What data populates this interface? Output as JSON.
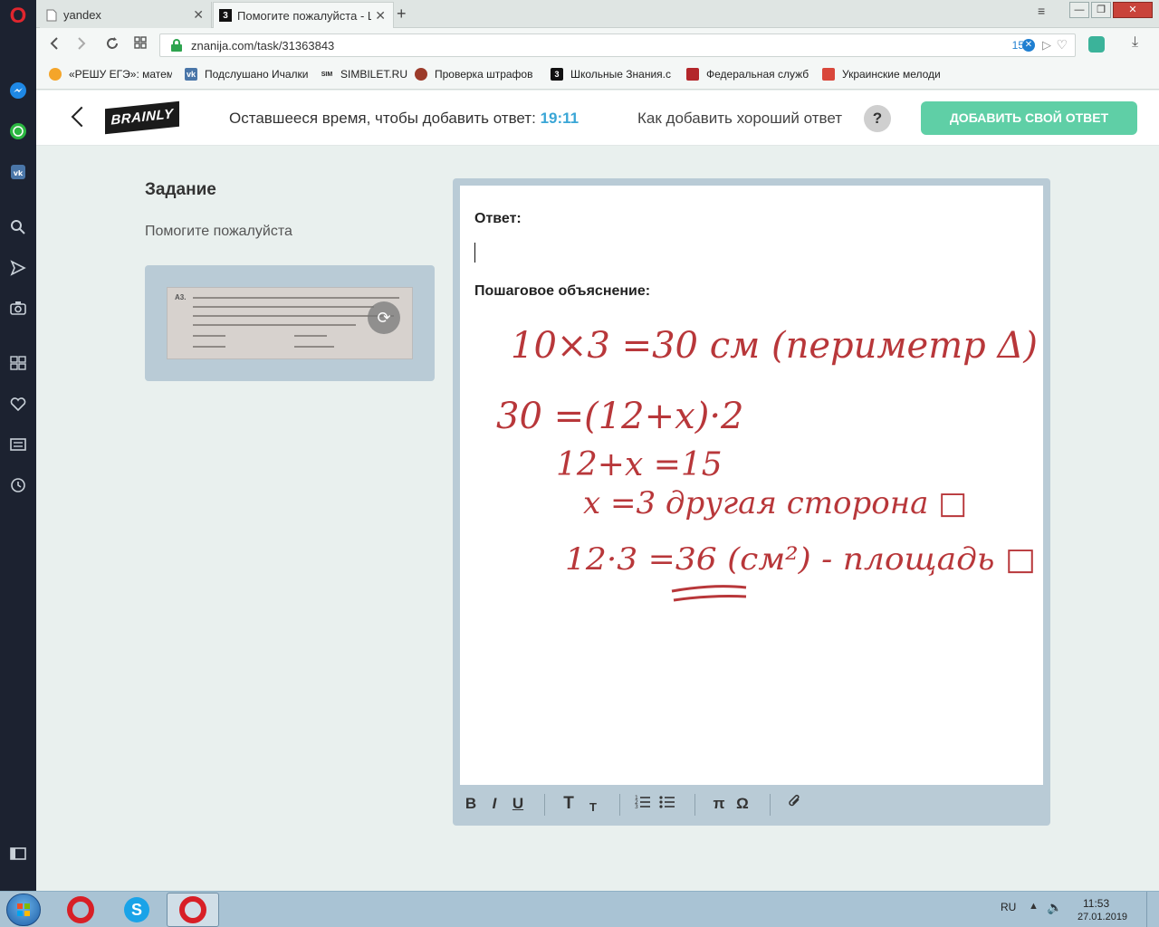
{
  "browser": {
    "tabs": [
      {
        "title": "yandex",
        "active": false
      },
      {
        "title": "Помогите пожалуйста - Ш",
        "active": true
      }
    ],
    "url": "znanija.com/task/31363843",
    "url_counter": "15",
    "bookmarks": [
      "«РЕШУ ЕГЭ»: матема",
      "Подслушано Ичалки",
      "SIMBILET.RU",
      "Проверка штрафов",
      "Школьные Знания.c",
      "Федеральная служб",
      "Украинские мелоди"
    ]
  },
  "header": {
    "logo": "BRAINLY",
    "timer_label": "Оставшееся время, чтобы добавить ответ:",
    "timer_value": "19:11",
    "howto_label": "Как добавить хороший ответ",
    "help_symbol": "?",
    "add_answer_button": "Добавить свой ответ"
  },
  "task": {
    "heading": "Задание",
    "text": "Помогите пожалуйста",
    "attachment_label": "А3."
  },
  "editor": {
    "answer_label": "Ответ:",
    "steps_label": "Пошаговое объяснение:",
    "handwriting_lines": [
      "10×3 =30 см (периметр Δ)",
      "30 =(12+x)·2",
      "12+x =15",
      "x =3 другая сторона □",
      "12·3 =36 (см²) - площадь □"
    ],
    "toolbar": {
      "bold": "B",
      "italic": "I",
      "underline": "U",
      "text_large": "T",
      "text_small": "T",
      "pi": "π",
      "omega": "Ω"
    }
  },
  "taskbar": {
    "language": "RU",
    "time": "11:53",
    "date": "27.01.2019"
  },
  "colors": {
    "accent_green": "#5fcfa6",
    "timer_blue": "#3aa6d6",
    "handwriting_red": "#b8373a",
    "panel_blue": "#b9cbd6"
  }
}
